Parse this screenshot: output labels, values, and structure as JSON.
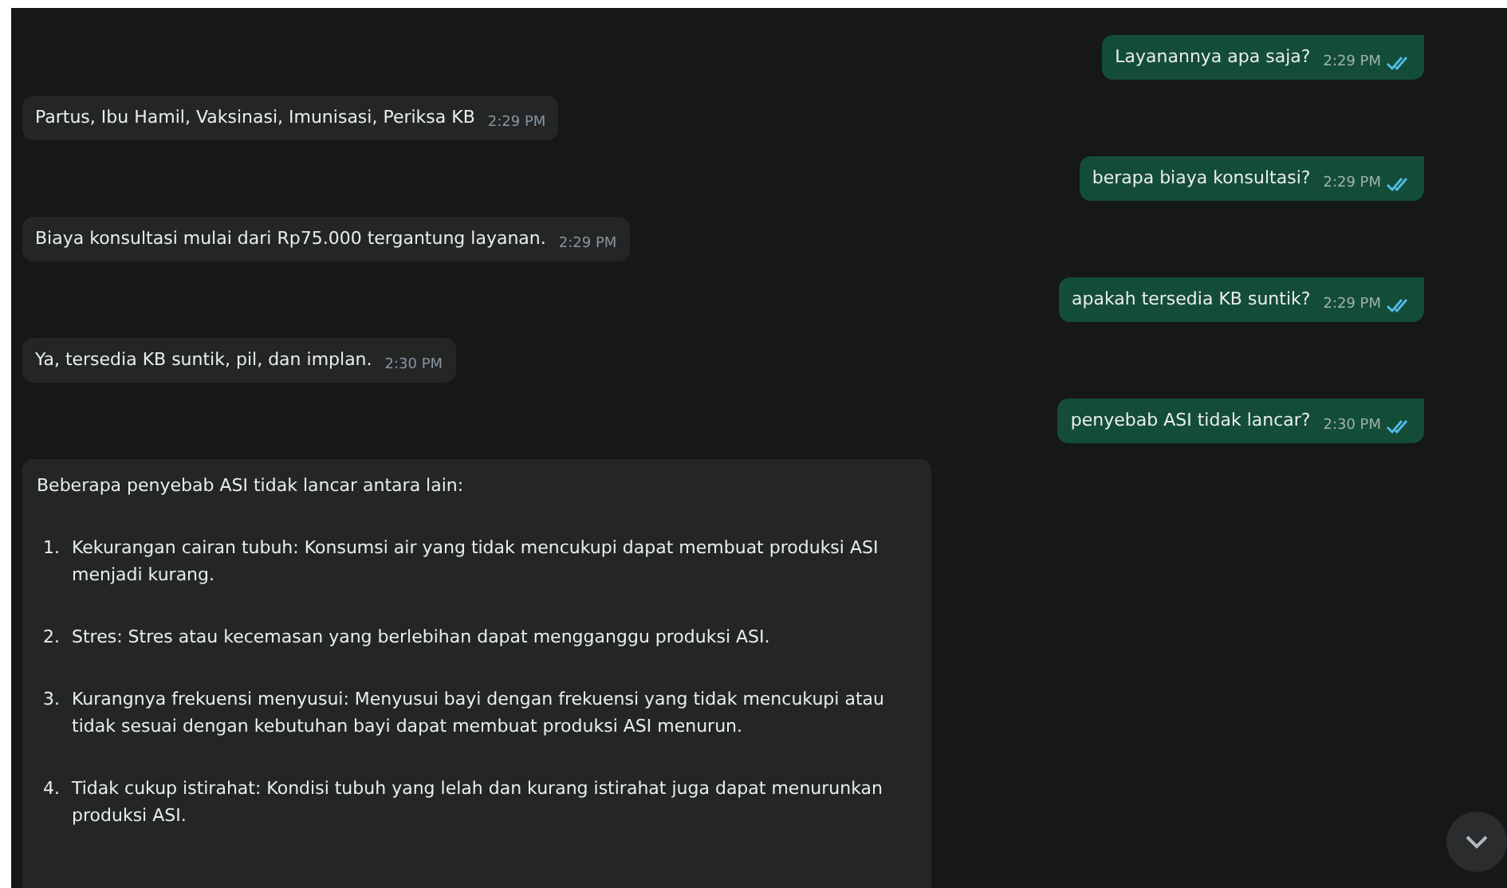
{
  "messages": [
    {
      "kind": "outgoing",
      "text": "Layanannya apa saja?",
      "time": "2:29 PM",
      "read": true
    },
    {
      "kind": "incoming",
      "text": "Partus, Ibu Hamil, Vaksinasi, Imunisasi, Periksa KB",
      "time": "2:29 PM"
    },
    {
      "kind": "outgoing",
      "text": "berapa biaya konsultasi?",
      "time": "2:29 PM",
      "read": true
    },
    {
      "kind": "incoming",
      "text": "Biaya konsultasi mulai dari Rp75.000 tergantung layanan.",
      "time": "2:29 PM"
    },
    {
      "kind": "outgoing",
      "text": "apakah tersedia KB suntik?",
      "time": "2:29 PM",
      "read": true
    },
    {
      "kind": "incoming",
      "text": "Ya, tersedia KB suntik, pil, dan implan.",
      "time": "2:30 PM"
    },
    {
      "kind": "outgoing",
      "text": "penyebab ASI tidak lancar?",
      "time": "2:30 PM",
      "read": true
    },
    {
      "kind": "list",
      "text": "Beberapa penyebab ASI tidak lancar antara lain:",
      "items": [
        {
          "number": "1.",
          "text": "Kekurangan cairan tubuh: Konsumsi air yang tidak mencukupi dapat membuat produksi ASI menjadi kurang."
        },
        {
          "number": "2.",
          "text": "Stres: Stres atau kecemasan yang berlebihan dapat mengganggu produksi ASI."
        },
        {
          "number": "3.",
          "text": "Kurangnya frekuensi menyusui: Menyusui bayi dengan frekuensi yang tidak mencukupi atau tidak sesuai dengan kebutuhan bayi dapat membuat produksi ASI menurun."
        },
        {
          "number": "4.",
          "text": "Tidak cukup istirahat: Kondisi tubuh yang lelah dan kurang istirahat juga dapat menurunkan produksi ASI."
        }
      ]
    }
  ]
}
